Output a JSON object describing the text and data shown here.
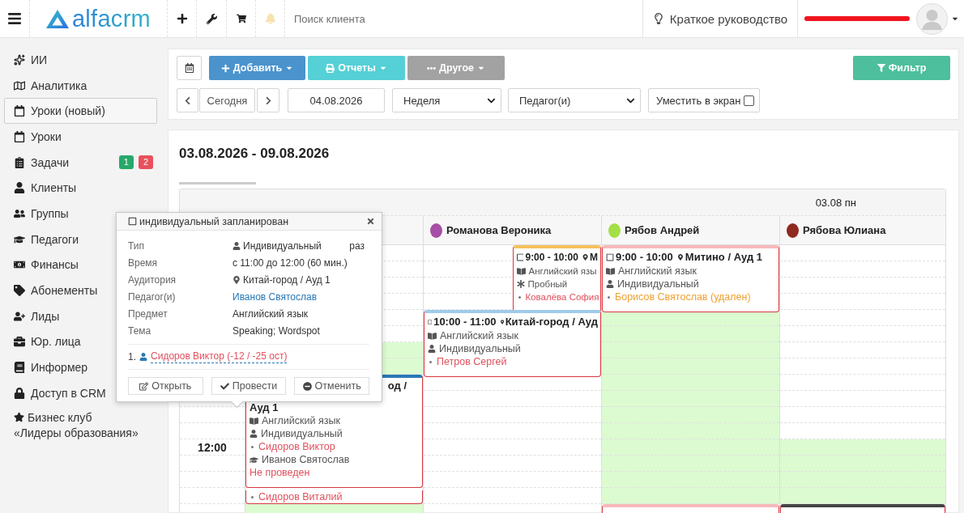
{
  "topbar": {
    "logo": "alfacrm",
    "search": {
      "placeholder": "Поиск клиента"
    },
    "guide": "Краткое руководство"
  },
  "sidebar": {
    "items": [
      {
        "label": "ИИ",
        "selected": false
      },
      {
        "label": "Аналитика",
        "selected": false
      },
      {
        "label": "Уроки (новый)",
        "selected": true
      },
      {
        "label": "Уроки",
        "selected": false
      },
      {
        "label": "Задачи",
        "selected": false,
        "badges": [
          {
            "text": "1",
            "color": "#27a86a"
          },
          {
            "text": "2",
            "color": "#e8505b"
          }
        ]
      },
      {
        "label": "Клиенты",
        "selected": false
      },
      {
        "label": "Группы",
        "selected": false
      },
      {
        "label": "Педагоги",
        "selected": false
      },
      {
        "label": "Финансы",
        "selected": false
      },
      {
        "label": "Абонементы",
        "selected": false
      },
      {
        "label": "Лиды",
        "selected": false
      },
      {
        "label": "Юр. лица",
        "selected": false
      },
      {
        "label": "Информер",
        "selected": false
      },
      {
        "label": "Доступ в CRM",
        "selected": false
      }
    ],
    "club_link": {
      "lines": [
        "Бизнес клуб",
        "«Лидеры образования»"
      ]
    }
  },
  "toolbar": {
    "buttons": [
      {
        "label": "Добавить",
        "kind": "add",
        "disabled": false
      },
      {
        "label": "Отчеты",
        "kind": "reports",
        "disabled": false
      },
      {
        "label": "Другое",
        "kind": "more",
        "disabled": true
      }
    ],
    "filter": {
      "label": "Фильтр"
    },
    "today": "Сегодня",
    "date": {
      "value": "04.08.2026"
    },
    "view_select": {
      "value": "Неделя"
    },
    "teacher_select": {
      "value": "Педагог(и)"
    },
    "fit_screen": {
      "label": "Уместить в экран",
      "checked": false
    }
  },
  "calendar": {
    "title": "03.08.2026 - 09.08.2026",
    "day": "03.08 пн",
    "time_labels": [
      "12:00"
    ],
    "columns": [
      {
        "blocks": [
          {
            "kind": "slot",
            "available": false
          },
          {
            "kind": "slot",
            "available": false
          },
          {
            "kind": "slot",
            "available": false
          },
          {
            "kind": "slot",
            "available": true
          },
          {
            "kind": "lesson",
            "color": "#2a78b4",
            "lines": [
              {
                "kind": "heading_tail",
                "text": "од /"
              },
              {
                "kind": "heading",
                "text": "Ауд 1"
              },
              {
                "kind": "subject",
                "text": "Английский язык"
              },
              {
                "kind": "type",
                "text": "Индивидуальный"
              },
              {
                "kind": "student",
                "text": "Сидоров Виктор",
                "deleted": false
              },
              {
                "kind": "teacher",
                "text": "Иванов Святослав"
              },
              {
                "kind": "status",
                "text": "Не проведен"
              }
            ]
          },
          {
            "kind": "lesson",
            "partly_hidden": true,
            "lines": [
              {
                "kind": "student",
                "text": "Сидоров Виталий",
                "deleted": false
              }
            ]
          },
          {
            "kind": "slot",
            "available": true
          }
        ]
      },
      {
        "teacher": "Романова Вероника",
        "color": "#a64fa6",
        "blocks": [
          {
            "kind": "lesson",
            "overlapping": true,
            "color": "#f6c25c",
            "checked": false,
            "time": "9:00 - 10:00",
            "place": "М",
            "lines": [
              {
                "kind": "subject",
                "text": "Английский язы"
              },
              {
                "kind": "trial",
                "text": "Пробный"
              },
              {
                "kind": "student",
                "text": "Ковалёва София",
                "deleted": false
              }
            ]
          },
          {
            "kind": "lesson",
            "color": "#9fcbea",
            "checked": false,
            "time": "10:00 - 11:00",
            "place": "Китай-город / Ауд",
            "lines": [
              {
                "kind": "subject",
                "text": "Английский язык"
              },
              {
                "kind": "type",
                "text": "Индивидуальный"
              },
              {
                "kind": "student",
                "text": "Петров Сергей",
                "deleted": false
              }
            ]
          },
          {
            "kind": "slot",
            "available": false
          },
          {
            "kind": "slot",
            "available": false
          },
          {
            "kind": "slot",
            "available": false
          },
          {
            "kind": "slot",
            "available": false
          },
          {
            "kind": "slot",
            "available": false
          }
        ]
      },
      {
        "teacher": "Рябов Андрей",
        "color": "#a3df47",
        "blocks": [
          {
            "kind": "lesson",
            "color": "#f7b9bb",
            "checked": false,
            "time": "9:00 - 10:00",
            "place": "Митино / Ауд 1",
            "lines": [
              {
                "kind": "subject",
                "text": "Английский язык"
              },
              {
                "kind": "type",
                "text": "Индивидуальный"
              },
              {
                "kind": "student",
                "text": "Борисов Святослав (удален)",
                "deleted": true
              }
            ]
          },
          {
            "kind": "slot",
            "available": true
          },
          {
            "kind": "slot",
            "available": true
          },
          {
            "kind": "slot",
            "available": true
          },
          {
            "kind": "slot",
            "available": true
          },
          {
            "kind": "slot",
            "available": true
          },
          {
            "kind": "slot",
            "available": true
          },
          {
            "kind": "lesson",
            "color": "#f7b9bb"
          }
        ]
      },
      {
        "teacher": "Рябова Юлиана",
        "color": "#8e2a20",
        "blocks": [
          {
            "kind": "slot",
            "available": false
          },
          {
            "kind": "slot",
            "available": false
          },
          {
            "kind": "slot",
            "available": false
          },
          {
            "kind": "slot",
            "available": false
          },
          {
            "kind": "slot",
            "available": false
          },
          {
            "kind": "slot",
            "available": false
          },
          {
            "kind": "slot",
            "available": true
          },
          {
            "kind": "slot",
            "available": true
          },
          {
            "kind": "lesson",
            "color": "#444444"
          }
        ]
      }
    ]
  },
  "popup": {
    "checked": false,
    "title": "индивидуальный запланирован",
    "fields": [
      {
        "label": "Тип",
        "value": "Индивидуальный",
        "kind": "type",
        "extra": "раз"
      },
      {
        "label": "Время",
        "value": "с 11:00 до 12:00 (60 мин.)",
        "kind": "text"
      },
      {
        "label": "Аудитория",
        "value": "Китай-город / Ауд 1",
        "kind": "place"
      },
      {
        "label": "Педагог(и)",
        "value": "Иванов Святослав",
        "kind": "link"
      },
      {
        "label": "Предмет",
        "value": "Английский язык",
        "kind": "text"
      },
      {
        "label": "Тема",
        "value": "Speaking; Wordspot",
        "kind": "text"
      }
    ],
    "students": [
      {
        "number": "1.",
        "name": "Сидоров Виктор (-12 / -25 ост)"
      }
    ],
    "buttons": [
      {
        "label": "Открыть",
        "kind": "open"
      },
      {
        "label": "Провести",
        "kind": "conduct"
      },
      {
        "label": "Отменить",
        "kind": "cancel"
      }
    ]
  }
}
